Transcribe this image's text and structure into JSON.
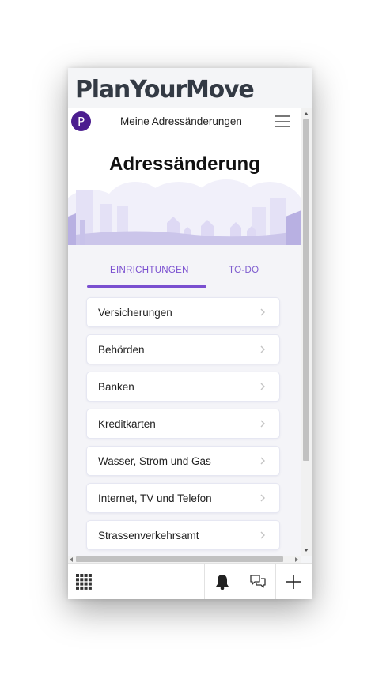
{
  "brand": {
    "title": "PlanYourMove"
  },
  "appbar": {
    "logo_letter": "P",
    "title": "Meine Adressänderungen",
    "menu_icon": "hamburger-menu-icon"
  },
  "hero": {
    "title": "Adressänderung",
    "colors": {
      "skyline": "#c8c2ea",
      "cloud": "#f3f2fb"
    }
  },
  "tabs": [
    {
      "label": "EINRICHTUNGEN",
      "active": true
    },
    {
      "label": "TO-DO",
      "active": false
    }
  ],
  "list": {
    "items": [
      {
        "label": "Versicherungen"
      },
      {
        "label": "Behörden"
      },
      {
        "label": "Banken"
      },
      {
        "label": "Kreditkarten"
      },
      {
        "label": "Wasser, Strom und Gas"
      },
      {
        "label": "Internet, TV und Telefon"
      },
      {
        "label": "Strassenverkehrsamt"
      }
    ],
    "chevron_icon": "chevron-right-icon"
  },
  "bottombar": {
    "icons": [
      "grid-apps-icon",
      "bell-icon",
      "chat-icon",
      "plus-icon"
    ]
  },
  "colors": {
    "accent": "#7a4fd0",
    "logo_bg": "#4b1d8f",
    "brand_text": "#333a44"
  }
}
